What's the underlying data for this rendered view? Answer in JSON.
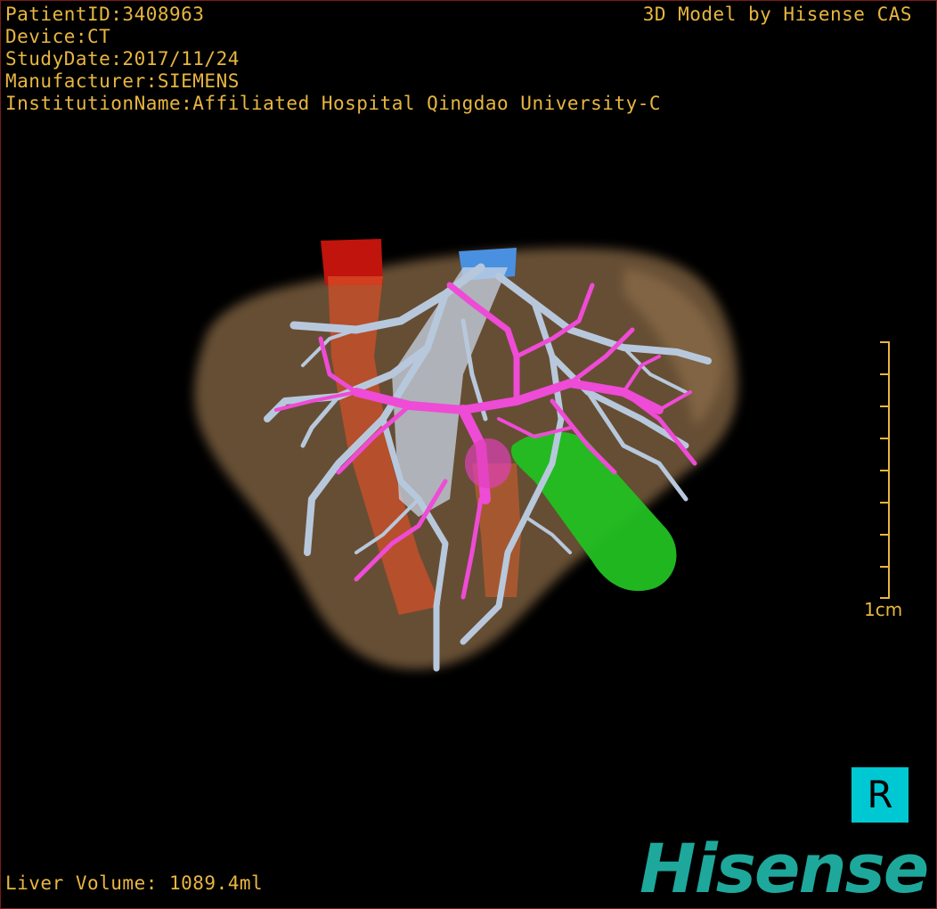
{
  "patient_info": {
    "patient_id": "PatientID:3408963",
    "device": "Device:CT",
    "study_date": "StudyDate:2017/11/24",
    "manufacturer": "Manufacturer:SIEMENS",
    "institution": "InstitutionName:Affiliated Hospital Qingdao University-C"
  },
  "credit": "3D Model by Hisense CAS",
  "scale_bar": {
    "label": "1cm"
  },
  "liver_volume": "Liver Volume: 1089.4ml",
  "orientation_marker": "R",
  "brand_logo": "Hisense",
  "colors": {
    "hud_text": "#e8b640",
    "liver": "#8a6a44",
    "hepatic_vein": "#b8c8dc",
    "portal_vein": "#ee4bd6",
    "artery": "#d82014",
    "gallbladder": "#22c022",
    "vena_cava_top": "#4a90e0",
    "orientation_bg": "#00c8d2",
    "logo": "#1ea89c"
  }
}
